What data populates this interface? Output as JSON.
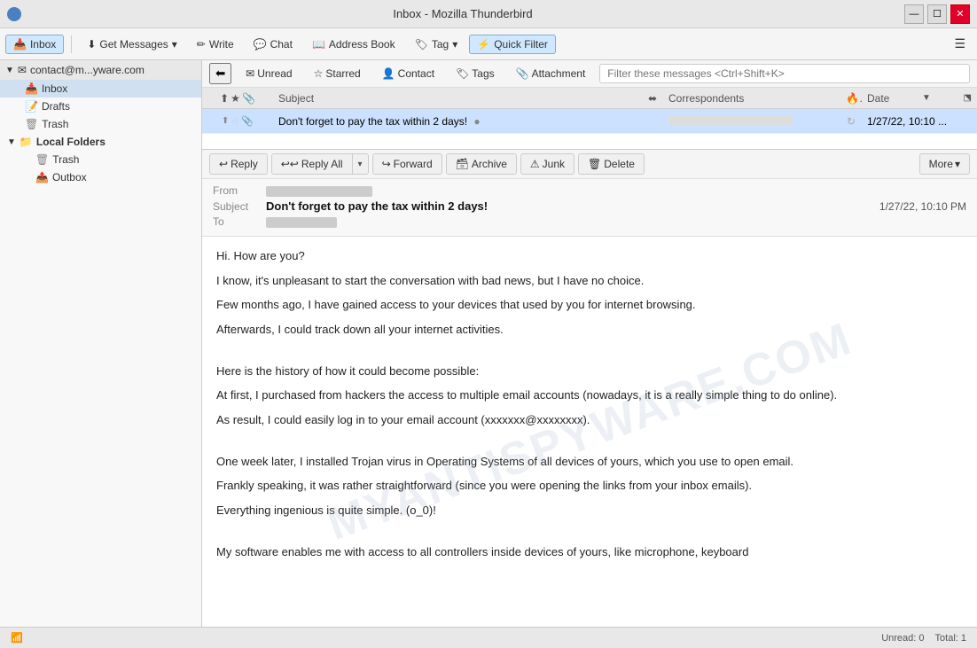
{
  "titlebar": {
    "title": "Inbox - Mozilla Thunderbird",
    "icon": "thunderbird"
  },
  "toolbar": {
    "inbox_label": "Inbox",
    "get_messages": "Get Messages",
    "write": "Write",
    "chat": "Chat",
    "address_book": "Address Book",
    "tag": "Tag",
    "quick_filter": "Quick Filter"
  },
  "sidebar": {
    "account": "contact@m...yware.com",
    "items": [
      {
        "id": "inbox",
        "label": "Inbox",
        "level": 2,
        "selected": true
      },
      {
        "id": "drafts",
        "label": "Drafts",
        "level": 2
      },
      {
        "id": "trash",
        "label": "Trash",
        "level": 2
      }
    ],
    "local_folders": {
      "label": "Local Folders",
      "items": [
        {
          "id": "local-trash",
          "label": "Trash"
        },
        {
          "id": "outbox",
          "label": "Outbox"
        }
      ]
    }
  },
  "filter_bar": {
    "unread": "Unread",
    "starred": "Starred",
    "contact": "Contact",
    "tags": "Tags",
    "attachment": "Attachment",
    "search_placeholder": "Filter these messages <Ctrl+Shift+K>"
  },
  "message_list": {
    "columns": {
      "subject": "Subject",
      "correspondents": "Correspondents",
      "date": "Date"
    },
    "messages": [
      {
        "id": "msg1",
        "subject": "Don't forget to pay the tax within 2 days!",
        "correspondents": "",
        "date": "1/27/22, 10:10 ...",
        "selected": true,
        "starred": false,
        "has_attachment": false
      }
    ]
  },
  "email_view": {
    "reply_buttons": {
      "reply": "Reply",
      "reply_all": "Reply All",
      "forward": "Forward",
      "archive": "Archive",
      "junk": "Junk",
      "delete": "Delete",
      "more": "More"
    },
    "header": {
      "from_label": "From",
      "subject_label": "Subject",
      "to_label": "To",
      "subject": "Don't forget to pay the tax within 2 days!",
      "date": "1/27/22, 10:10 PM"
    },
    "body": {
      "line1": "Hi. How are you?",
      "line2": "",
      "line3": "I know, it's unpleasant to start the conversation with bad news, but I have no choice.",
      "line4": "Few months ago, I have gained access to your devices that used by you for internet browsing.",
      "line5": "Afterwards, I could track down all your internet activities.",
      "line6": "",
      "line7": "Here is the history of how it could become possible:",
      "line8": "At first, I purchased from hackers the access to multiple email accounts (nowadays, it is a really simple thing to do online).",
      "line9": "As result, I could easily log in to your email account (xxxxxxx@xxxxxxxx).",
      "line10": "",
      "line11": "One week later, I installed Trojan virus in Operating Systems of all devices of yours, which you use to open email.",
      "line12": "Frankly speaking, it was rather straightforward (since you were opening the links from your inbox emails).",
      "line13": "Everything ingenious is quite simple. (o_0)!",
      "line14": "",
      "line15": "My software enables me with access to all controllers inside devices of yours, like microphone, keyboard"
    }
  },
  "status_bar": {
    "wifi_icon": "wifi",
    "unread": "Unread: 0",
    "total": "Total: 1"
  }
}
